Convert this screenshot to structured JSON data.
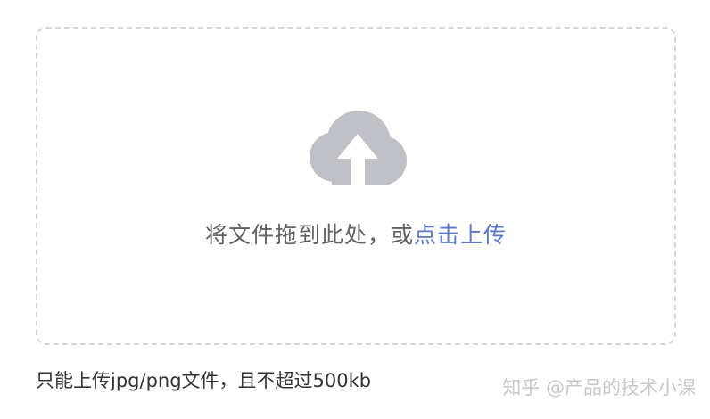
{
  "upload": {
    "icon": "cloud-upload-icon",
    "drop_text": "将文件拖到此处，或",
    "click_link": "点击上传",
    "tip": "只能上传jpg/png文件，且不超过500kb"
  },
  "watermark": {
    "text": "知乎 @产品的技术小课"
  },
  "colors": {
    "link": "#5b78c9",
    "icon": "#c0c1c6",
    "border": "#d6d6d6",
    "text": "#606266"
  }
}
